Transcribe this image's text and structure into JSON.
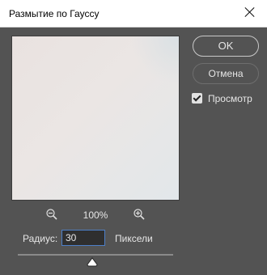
{
  "window": {
    "title": "Размытие по Гауссу"
  },
  "buttons": {
    "ok_label": "OK",
    "cancel_label": "Отмена"
  },
  "preview_checkbox": {
    "label": "Просмотр",
    "checked": true
  },
  "zoom": {
    "level": "100%",
    "zoom_out_icon": "zoom-out-icon",
    "zoom_in_icon": "zoom-in-icon"
  },
  "radius": {
    "label": "Радиус:",
    "value": "30",
    "units": "Пиксели"
  },
  "slider": {
    "position_fraction": 0.48
  },
  "colors": {
    "dialog_bg": "#535353",
    "titlebar_bg": "#ffffff",
    "input_focus_border": "#4d7fc8"
  }
}
